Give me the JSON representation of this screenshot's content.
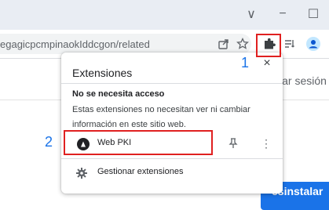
{
  "browser": {
    "url": "egagicpcmpinaokIddcgon/related",
    "window_controls": {
      "collapse": "∨",
      "minimize": "−",
      "maximize": "☐"
    },
    "toolbar_icons": [
      "share-icon",
      "bookmark-star-icon",
      "extensions-puzzle-icon",
      "reading-list-icon",
      "profile-icon"
    ]
  },
  "background_page": {
    "signin_text": "iar sesión",
    "uninstall_label": "esinstalar"
  },
  "extensions_popup": {
    "title": "Extensiones",
    "close": "×",
    "section_heading": "No se necesita acceso",
    "section_description": "Estas extensiones no necesitan ver ni cambiar información en este sitio web.",
    "extensions": [
      {
        "name": "Web PKI",
        "pin": "⊥",
        "more": "⋮"
      }
    ],
    "manage_label": "Gestionar extensiones"
  },
  "annotations": {
    "callout_1": "1",
    "callout_2": "2"
  },
  "colors": {
    "highlight": "#e02020",
    "callout": "#1a73e8",
    "accent": "#1a73e8",
    "titlebar": "#e9edf3"
  }
}
